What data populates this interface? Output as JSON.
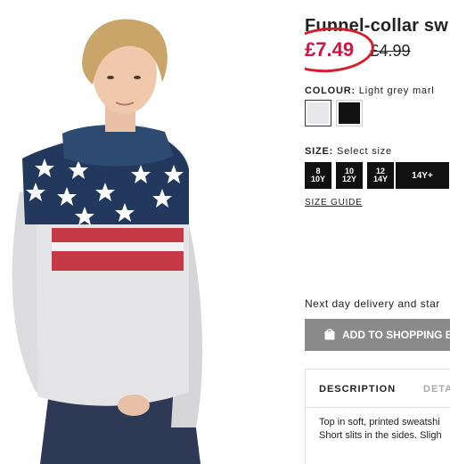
{
  "product": {
    "title": "Funnel-collar sw",
    "price_current": "£7.49",
    "price_old": "£4.99"
  },
  "colour": {
    "label": "COLOUR:",
    "value": "Light grey marl",
    "swatches": [
      "light-grey",
      "black"
    ],
    "swatch_colors": [
      "#e8e8ea",
      "#111111"
    ]
  },
  "size": {
    "label": "SIZE:",
    "prompt": "Select size",
    "options": [
      {
        "line1": "8",
        "line2": "10Y"
      },
      {
        "line1": "10",
        "line2": "12Y"
      },
      {
        "line1": "12",
        "line2": "14Y"
      },
      {
        "line1": "14Y+",
        "line2": ""
      }
    ],
    "guide": "SIZE GUIDE"
  },
  "delivery": "Next day delivery and star",
  "cart": {
    "label": "ADD TO SHOPPING B"
  },
  "tabs": {
    "description": "DESCRIPTION",
    "details": "DETA",
    "text_line1": "Top in soft, printed sweatshi",
    "text_line2": "Short slits in the sides. Sligh"
  },
  "colors": {
    "accent_red": "#d01345",
    "highlight_circle": "#d41e2a",
    "button_grey": "#8a8a8a"
  }
}
